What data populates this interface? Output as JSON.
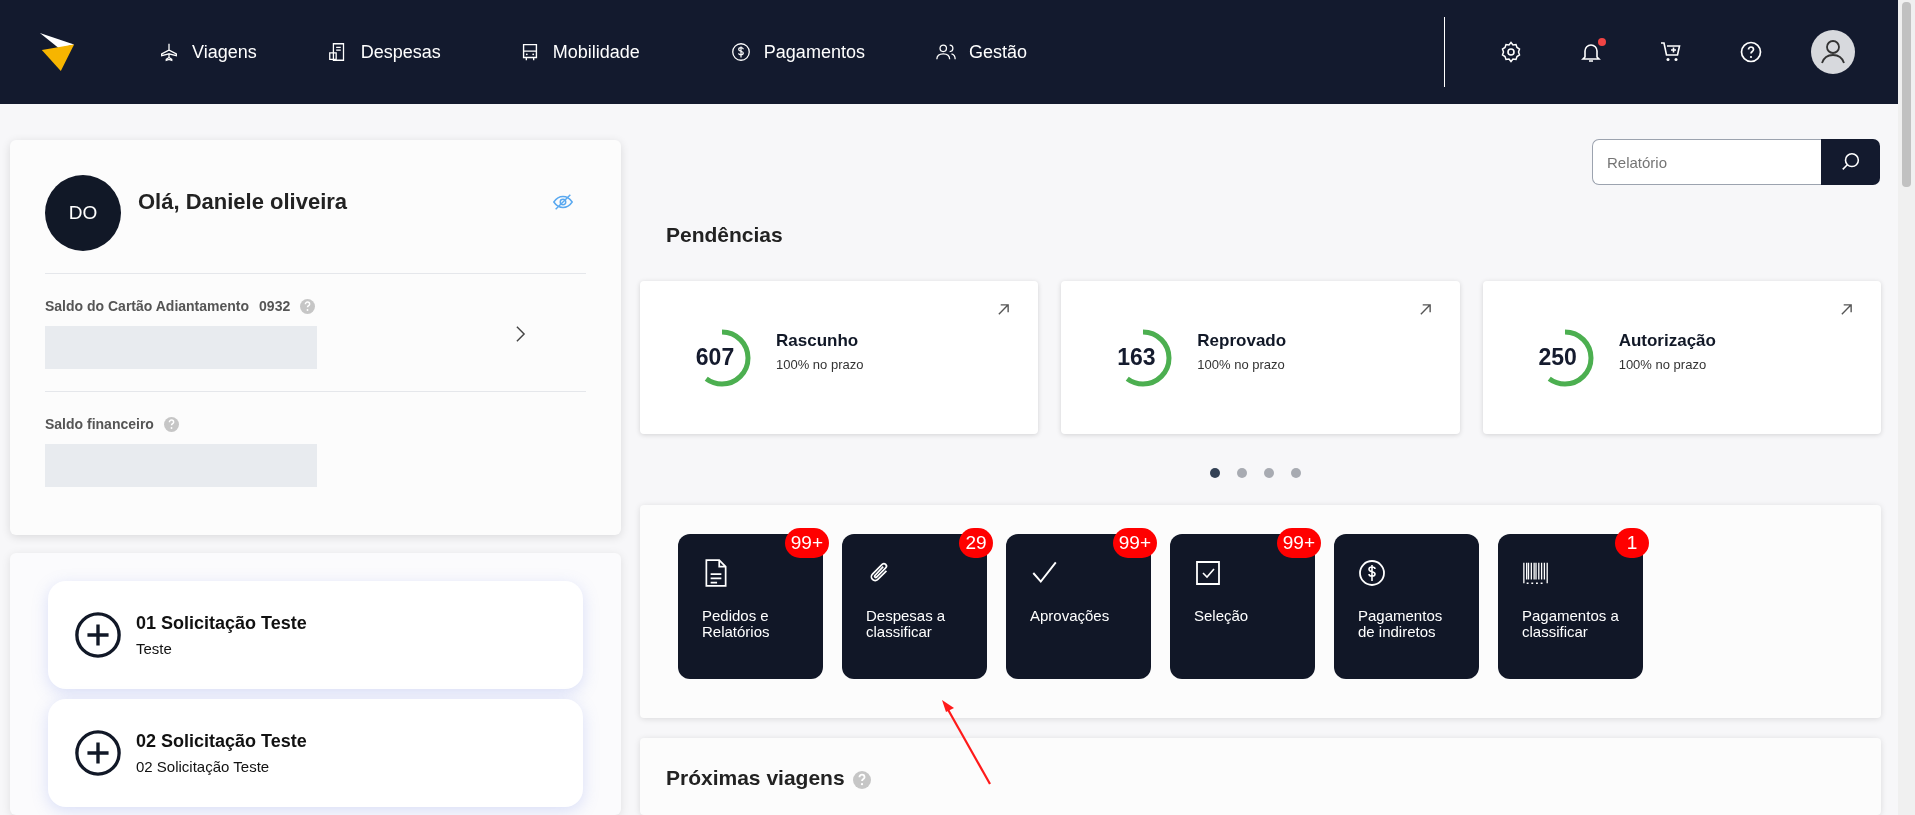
{
  "nav": {
    "items": [
      {
        "label": "Viagens"
      },
      {
        "label": "Despesas"
      },
      {
        "label": "Mobilidade"
      },
      {
        "label": "Pagamentos"
      },
      {
        "label": "Gestão"
      }
    ],
    "notification_dot": true
  },
  "profile": {
    "initials": "DO",
    "greeting": "Olá, Daniele oliveira",
    "card_label": "Saldo do Cartão Adiantamento",
    "card_number": "0932",
    "financial_label": "Saldo financeiro"
  },
  "requests": [
    {
      "title": "01 Solicitação Teste",
      "subtitle": "Teste"
    },
    {
      "title": "02 Solicitação Teste",
      "subtitle": "02 Solicitação Teste"
    }
  ],
  "search": {
    "placeholder": "Relatório"
  },
  "pending": {
    "title": "Pendências",
    "cards": [
      {
        "count": "607",
        "label": "Rascunho",
        "note": "100% no prazo",
        "level": 0.6
      },
      {
        "count": "163",
        "label": "Reprovado",
        "note": "100% no prazo",
        "level": 0.6
      },
      {
        "count": "250",
        "label": "Autorização",
        "note": "100% no prazo",
        "level": 0.6
      }
    ],
    "pages": [
      {
        "selected": true
      },
      {
        "selected": false
      },
      {
        "selected": false
      },
      {
        "selected": false
      }
    ]
  },
  "shortcuts": [
    {
      "label": "Pedidos e Relatórios",
      "badge": "99+"
    },
    {
      "label": "Despesas a classificar",
      "badge": "29"
    },
    {
      "label": "Aprovações",
      "badge": "99+"
    },
    {
      "label": "Seleção",
      "badge": "99+"
    },
    {
      "label": "Pagamentos de indiretos"
    },
    {
      "label": "Pagamentos a classificar",
      "badge": "1"
    }
  ],
  "upcoming_trips": {
    "title": "Próximas viagens"
  }
}
